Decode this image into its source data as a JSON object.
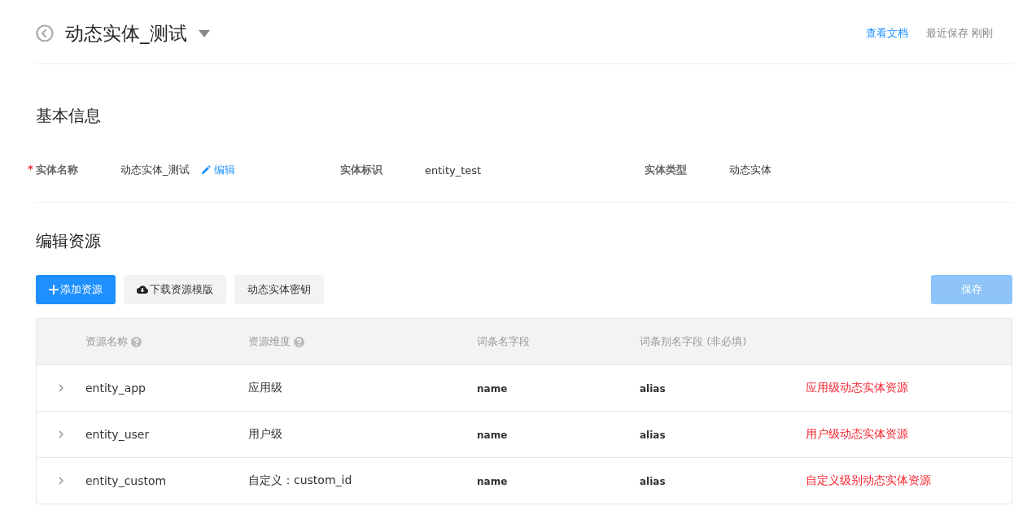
{
  "header": {
    "title": "动态实体_测试",
    "doc_link": "查看文档",
    "save_status": "最近保存 刚刚"
  },
  "basic_info": {
    "title": "基本信息",
    "fields": [
      {
        "label": "实体名称",
        "required_mark": "*",
        "value": "动态实体_测试",
        "edit_link": "编辑"
      },
      {
        "label": "实体标识",
        "value": "entity_test"
      },
      {
        "label": "实体类型",
        "value": "动态实体"
      }
    ]
  },
  "resources": {
    "title": "编辑资源",
    "buttons": [
      {
        "label": "添加资源",
        "kind": "primary"
      },
      {
        "label": "下载资源模版",
        "kind": "download"
      },
      {
        "label": "动态实体密钥",
        "kind": "plain"
      }
    ],
    "save_button": {
      "label": "保存",
      "disabled": true
    },
    "table": {
      "columns": [
        {
          "label": "资源名称",
          "help": true
        },
        {
          "label": "资源维度",
          "help": true
        },
        {
          "label": "词条名字段",
          "help": false
        },
        {
          "label": "词条别名字段 (非必填)",
          "help": false
        }
      ],
      "rows": [
        {
          "expanded": false,
          "name": "entity_app",
          "dimension": "应用级",
          "word_field": "name",
          "alias_field": "alias",
          "note": "应用级动态实体资源"
        },
        {
          "expanded": false,
          "name": "entity_user",
          "dimension": "用户级",
          "word_field": "name",
          "alias_field": "alias",
          "note": "用户级动态实体资源"
        },
        {
          "expanded": false,
          "name": "entity_custom",
          "dimension": "自定义：custom_id",
          "word_field": "name",
          "alias_field": "alias",
          "note": "自定义级别动态实体资源"
        }
      ]
    }
  }
}
